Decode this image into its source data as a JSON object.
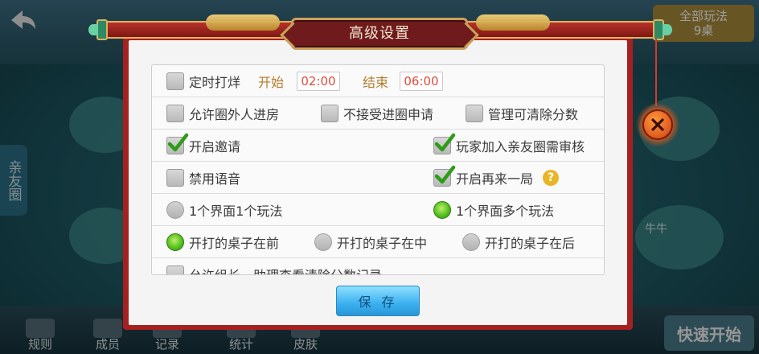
{
  "background": {
    "side_tab": "亲友圈",
    "all_play": {
      "line1": "全部玩法",
      "line2": "9桌"
    },
    "quick_start": "快速开始",
    "nav": [
      "规则",
      "成员",
      "记录",
      "统计",
      "皮肤"
    ],
    "table_labels": [
      "牛牛"
    ]
  },
  "dialog": {
    "title": "高级设置",
    "timer": {
      "label": "定时打烊",
      "start_label": "开始",
      "start_value": "02:00",
      "end_label": "结束",
      "end_value": "06:00",
      "checked": false
    },
    "options": [
      {
        "label": "允许圈外人进房",
        "checked": false
      },
      {
        "label": "不接受进圈申请",
        "checked": false
      },
      {
        "label": "管理可清除分数",
        "checked": false
      },
      {
        "label": "开启邀请",
        "checked": true
      },
      {
        "label": "玩家加入亲友圈需审核",
        "checked": true
      },
      {
        "label": "禁用语音",
        "checked": false
      },
      {
        "label": "开启再来一局",
        "checked": true
      },
      {
        "label": "允许组长、助理查看清除分数记录",
        "checked": false
      }
    ],
    "help_glyph": "?",
    "layout_radios": [
      {
        "label": "1个界面1个玩法",
        "selected": false
      },
      {
        "label": "1个界面多个玩法",
        "selected": true
      }
    ],
    "order_radios": [
      {
        "label": "开打的桌子在前",
        "selected": true
      },
      {
        "label": "开打的桌子在中",
        "selected": false
      },
      {
        "label": "开打的桌子在后",
        "selected": false
      }
    ],
    "save_label": "保 存",
    "close_icon": "close-icon"
  }
}
